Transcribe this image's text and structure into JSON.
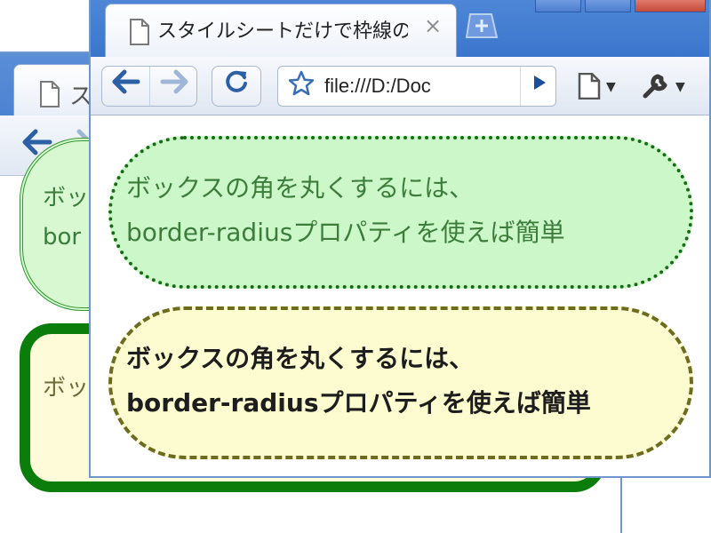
{
  "back_window": {
    "tab_title": "スタ",
    "box1_lines": [
      "ボッ",
      "bor"
    ],
    "box2_line": "ボッ"
  },
  "front_window": {
    "tab_title": "スタイルシートだけで枠線の...",
    "tab_close": "×",
    "address": "file:///D:/Doc",
    "nav": {
      "back_glyph": "←",
      "forward_glyph": "→",
      "reload_glyph": "↻",
      "go_glyph": "▶",
      "star_glyph": "☆"
    },
    "content": {
      "green_box_lines": [
        "ボックスの角を丸くするには、",
        "border-radiusプロパティを使えば簡単"
      ],
      "yellow_box_lines": [
        "ボックスの角を丸くするには、",
        "border-radiusプロパティを使えば簡単"
      ]
    }
  },
  "icons": {
    "page": "page-icon",
    "close": "close-icon",
    "back": "back-arrow-icon",
    "forward": "forward-arrow-icon",
    "reload": "reload-icon",
    "star": "star-icon",
    "go": "play-icon",
    "page_menu": "page-menu-icon",
    "tools_menu": "wrench-icon"
  },
  "colors": {
    "frame_blue": "#3b76cd",
    "green_box_bg": "#ccf7c8",
    "green_border": "#156c15",
    "yellow_box_bg": "#fdfcd0",
    "olive_border": "#6d6b1d",
    "back_box2_border": "#0a7d0a"
  }
}
